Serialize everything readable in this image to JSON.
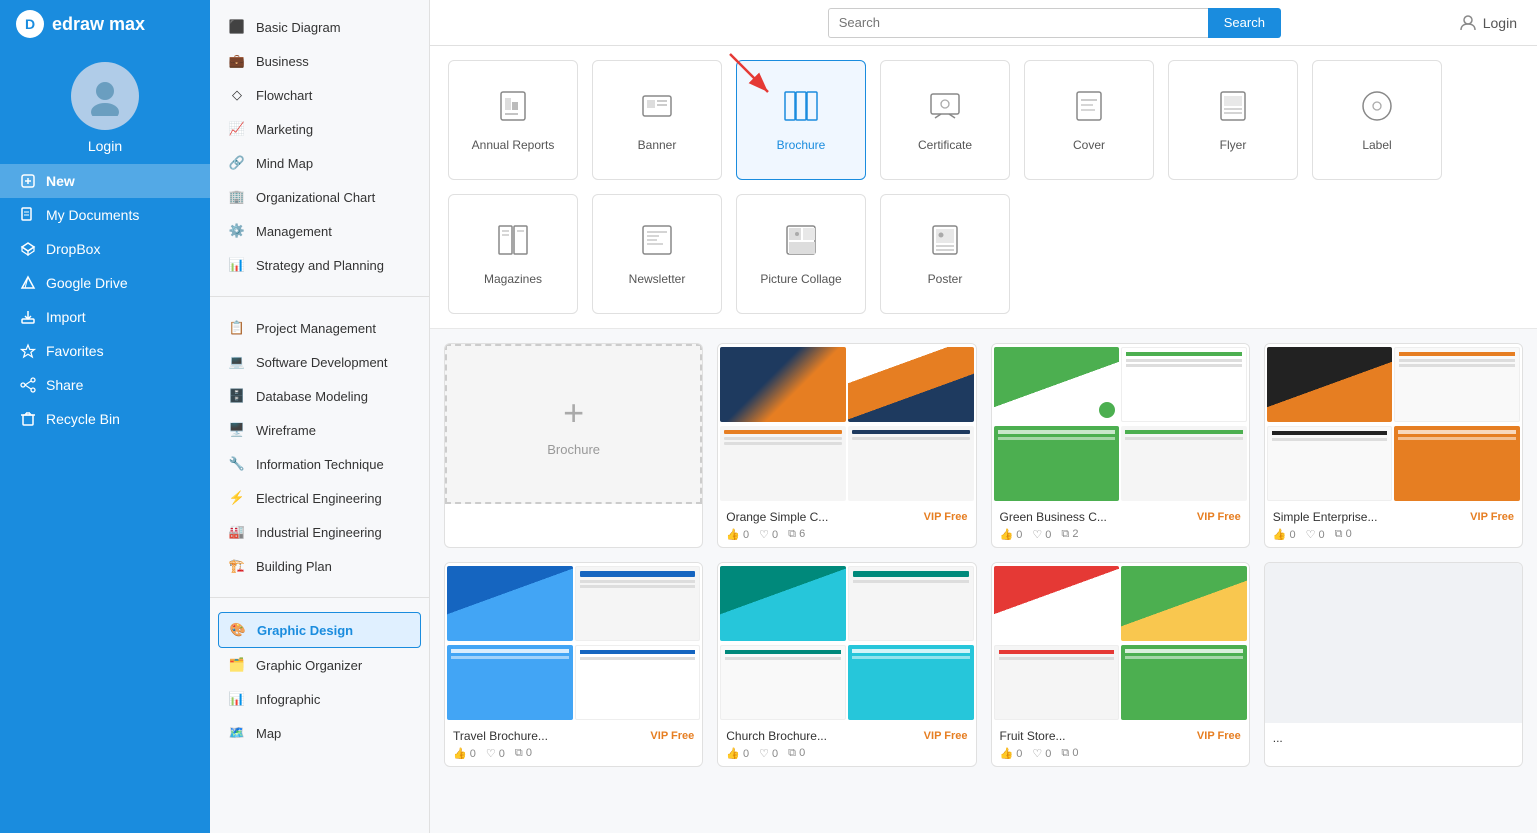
{
  "app": {
    "logo_text": "edraw max",
    "login_label": "Login"
  },
  "sidebar": {
    "avatar_alt": "user avatar",
    "login_label": "Login",
    "nav_items": [
      {
        "id": "new",
        "label": "New",
        "active": true
      },
      {
        "id": "my-documents",
        "label": "My Documents",
        "active": false
      },
      {
        "id": "dropbox",
        "label": "DropBox",
        "active": false
      },
      {
        "id": "google-drive",
        "label": "Google Drive",
        "active": false
      },
      {
        "id": "import",
        "label": "Import",
        "active": false
      },
      {
        "id": "favorites",
        "label": "Favorites",
        "active": false
      },
      {
        "id": "share",
        "label": "Share",
        "active": false
      },
      {
        "id": "recycle-bin",
        "label": "Recycle Bin",
        "active": false
      }
    ]
  },
  "middle_nav": {
    "sections": [
      {
        "items": [
          {
            "id": "basic-diagram",
            "label": "Basic Diagram"
          },
          {
            "id": "business",
            "label": "Business"
          },
          {
            "id": "flowchart",
            "label": "Flowchart"
          },
          {
            "id": "marketing",
            "label": "Marketing"
          },
          {
            "id": "mind-map",
            "label": "Mind Map"
          },
          {
            "id": "organizational-chart",
            "label": "Organizational Chart"
          },
          {
            "id": "management",
            "label": "Management"
          },
          {
            "id": "strategy-and-planning",
            "label": "Strategy and Planning"
          }
        ]
      },
      {
        "items": [
          {
            "id": "project-management",
            "label": "Project Management"
          },
          {
            "id": "software-development",
            "label": "Software Development"
          },
          {
            "id": "database-modeling",
            "label": "Database Modeling"
          },
          {
            "id": "wireframe",
            "label": "Wireframe"
          },
          {
            "id": "information-technique",
            "label": "Information Technique"
          },
          {
            "id": "electrical-engineering",
            "label": "Electrical Engineering"
          },
          {
            "id": "industrial-engineering",
            "label": "Industrial Engineering"
          },
          {
            "id": "building-plan",
            "label": "Building Plan"
          }
        ]
      },
      {
        "items": [
          {
            "id": "graphic-design",
            "label": "Graphic Design",
            "active": true
          },
          {
            "id": "graphic-organizer",
            "label": "Graphic Organizer"
          },
          {
            "id": "infographic",
            "label": "Infographic"
          },
          {
            "id": "map",
            "label": "Map"
          }
        ]
      }
    ]
  },
  "topbar": {
    "search_placeholder": "Search",
    "search_button_label": "Search",
    "login_label": "Login"
  },
  "categories": [
    {
      "id": "annual-reports",
      "label": "Annual Reports",
      "icon": "📊",
      "active": false
    },
    {
      "id": "banner",
      "label": "Banner",
      "icon": "🖼️",
      "active": false
    },
    {
      "id": "brochure",
      "label": "Brochure",
      "icon": "📋",
      "active": true
    },
    {
      "id": "certificate",
      "label": "Certificate",
      "icon": "📜",
      "active": false
    },
    {
      "id": "cover",
      "label": "Cover",
      "icon": "📰",
      "active": false
    },
    {
      "id": "flyer",
      "label": "Flyer",
      "icon": "📄",
      "active": false
    },
    {
      "id": "label",
      "label": "Label",
      "icon": "🏷️",
      "active": false
    },
    {
      "id": "magazines",
      "label": "Magazines",
      "icon": "📒",
      "active": false
    },
    {
      "id": "newsletter",
      "label": "Newsletter",
      "icon": "📰",
      "active": false
    },
    {
      "id": "picture-collage",
      "label": "Picture Collage",
      "icon": "🖼️",
      "active": false
    },
    {
      "id": "poster",
      "label": "Poster",
      "icon": "🖼️",
      "active": false
    }
  ],
  "templates": [
    {
      "id": "blank",
      "type": "blank",
      "label": "Brochure",
      "badge": ""
    },
    {
      "id": "orange-simple",
      "type": "orange",
      "label": "Orange Simple C...",
      "badge": "VIP Free",
      "likes": 0,
      "hearts": 0,
      "copies": 6
    },
    {
      "id": "green-business",
      "type": "green",
      "label": "Green Business C...",
      "badge": "VIP Free",
      "likes": 0,
      "hearts": 0,
      "copies": 2
    },
    {
      "id": "simple-enterprise",
      "type": "dark",
      "label": "Simple Enterprise...",
      "badge": "VIP Free",
      "likes": 0,
      "hearts": 0,
      "copies": 0
    },
    {
      "id": "travel1",
      "type": "travel1",
      "label": "",
      "badge": "",
      "likes": 0,
      "hearts": 0,
      "copies": 0
    },
    {
      "id": "church",
      "type": "church",
      "label": "",
      "badge": "",
      "likes": 0,
      "hearts": 0,
      "copies": 0
    },
    {
      "id": "fruit",
      "type": "fruit",
      "label": "",
      "badge": "",
      "likes": 0,
      "hearts": 0,
      "copies": 0
    }
  ]
}
